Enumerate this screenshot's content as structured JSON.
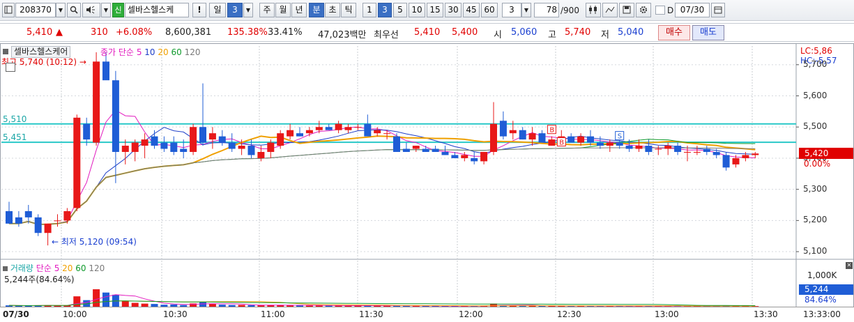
{
  "toolbar": {
    "code": "208370",
    "credit_badge": "신",
    "stock_name": "셀바스헬스케",
    "exclaim": "!",
    "period_label": "일",
    "period_value": "3",
    "periods": [
      "주",
      "월",
      "년",
      "분",
      "초",
      "틱"
    ],
    "interval_numbers": [
      "1",
      "3",
      "5",
      "10",
      "15",
      "30",
      "45",
      "60"
    ],
    "interval_value": "3",
    "count_value": "78",
    "count_total": "/900",
    "date_value": "07/30",
    "d_label": "D",
    "icons": [
      "chart-type-icon",
      "search-icon",
      "speaker-icon",
      "candle-settings-icon",
      "crosshair-icon",
      "save-icon",
      "gear-icon",
      "calendar-icon"
    ]
  },
  "infobar": {
    "price": "5,410",
    "change_arrow": "▲",
    "change": "310",
    "change_pct": "+6.08%",
    "volume": "8,600,381",
    "volume_ratio": "135.38%",
    "turnover": "33.41%",
    "amount": "47,023백만",
    "best_label": "최우선",
    "best_ask": "5,410",
    "best_bid": "5,400",
    "open_label": "시",
    "open": "5,060",
    "high_label": "고",
    "high": "5,740",
    "low_label": "저",
    "low": "5,040",
    "buy_button": "매수",
    "sell_button": "매도"
  },
  "price_chart": {
    "tab_label": "셀바스헬스케어",
    "legend_prefix": "종가 단순",
    "ma_periods": [
      "5",
      "10",
      "20",
      "60",
      "120"
    ],
    "ma_colors": [
      "#e21bbf",
      "#1f3fc8",
      "#f0a000",
      "#0f9a2c",
      "#7a7a7a"
    ],
    "high_annotation": "최고 5,740 (10:12)",
    "low_annotation": "최저 5,120 (09:54)",
    "line1_label": "5,510",
    "line2_label": "5,451",
    "lc_label": "LC:5,86",
    "hc_label": "HC:-5,57",
    "price_tag": "5,420",
    "pct_tag": "0.00%",
    "scale": [
      "5,700",
      "5,600",
      "5,500",
      "5,400",
      "5,300",
      "5,200",
      "5,100"
    ],
    "marker_b": "B",
    "marker_s": "S"
  },
  "volume_chart": {
    "legend_label": "거래량",
    "legend_prefix": "단순",
    "ma_periods": [
      "5",
      "20",
      "60",
      "120"
    ],
    "ma_colors": [
      "#e21bbf",
      "#f0a000",
      "#0f9a2c",
      "#7a7a7a"
    ],
    "value_label": "5,244주(84.64%)",
    "scale_top": "1,000K",
    "value_tag": "5,244",
    "pct_tag": "84.64%"
  },
  "time_axis": {
    "date": "07/30",
    "times": [
      "10:00",
      "10:30",
      "11:00",
      "11:30",
      "12:00",
      "12:30",
      "13:00",
      "13:30"
    ],
    "clock": "13:33:00"
  },
  "chart_data": {
    "type": "candlestick",
    "interval": "3분",
    "y_range": [
      5080,
      5760
    ],
    "candles": [
      {
        "o": 5230,
        "h": 5260,
        "l": 5190,
        "c": 5190
      },
      {
        "o": 5210,
        "h": 5230,
        "l": 5180,
        "c": 5190
      },
      {
        "o": 5230,
        "h": 5250,
        "l": 5190,
        "c": 5210
      },
      {
        "o": 5210,
        "h": 5220,
        "l": 5150,
        "c": 5160
      },
      {
        "o": 5160,
        "h": 5190,
        "l": 5120,
        "c": 5190
      },
      {
        "o": 5200,
        "h": 5220,
        "l": 5180,
        "c": 5200
      },
      {
        "o": 5200,
        "h": 5240,
        "l": 5190,
        "c": 5230
      },
      {
        "o": 5240,
        "h": 5540,
        "l": 5230,
        "c": 5530
      },
      {
        "o": 5510,
        "h": 5530,
        "l": 5440,
        "c": 5460
      },
      {
        "o": 5450,
        "h": 5740,
        "l": 5440,
        "c": 5710
      },
      {
        "o": 5710,
        "h": 5740,
        "l": 5660,
        "c": 5650
      },
      {
        "o": 5650,
        "h": 5680,
        "l": 5320,
        "c": 5420
      },
      {
        "o": 5420,
        "h": 5460,
        "l": 5380,
        "c": 5440
      },
      {
        "o": 5420,
        "h": 5460,
        "l": 5390,
        "c": 5450
      },
      {
        "o": 5440,
        "h": 5480,
        "l": 5400,
        "c": 5460
      },
      {
        "o": 5470,
        "h": 5490,
        "l": 5430,
        "c": 5440
      },
      {
        "o": 5450,
        "h": 5470,
        "l": 5420,
        "c": 5430
      },
      {
        "o": 5450,
        "h": 5470,
        "l": 5410,
        "c": 5420
      },
      {
        "o": 5430,
        "h": 5460,
        "l": 5400,
        "c": 5420
      },
      {
        "o": 5420,
        "h": 5510,
        "l": 5410,
        "c": 5500
      },
      {
        "o": 5500,
        "h": 5640,
        "l": 5440,
        "c": 5450
      },
      {
        "o": 5460,
        "h": 5500,
        "l": 5430,
        "c": 5480
      },
      {
        "o": 5470,
        "h": 5490,
        "l": 5440,
        "c": 5450
      },
      {
        "o": 5450,
        "h": 5480,
        "l": 5420,
        "c": 5430
      },
      {
        "o": 5430,
        "h": 5460,
        "l": 5410,
        "c": 5440
      },
      {
        "o": 5440,
        "h": 5460,
        "l": 5400,
        "c": 5410
      },
      {
        "o": 5400,
        "h": 5440,
        "l": 5390,
        "c": 5420
      },
      {
        "o": 5420,
        "h": 5460,
        "l": 5400,
        "c": 5450
      },
      {
        "o": 5440,
        "h": 5490,
        "l": 5430,
        "c": 5480
      },
      {
        "o": 5470,
        "h": 5510,
        "l": 5460,
        "c": 5490
      },
      {
        "o": 5480,
        "h": 5500,
        "l": 5470,
        "c": 5470
      },
      {
        "o": 5480,
        "h": 5500,
        "l": 5470,
        "c": 5490
      },
      {
        "o": 5490,
        "h": 5520,
        "l": 5480,
        "c": 5500
      },
      {
        "o": 5500,
        "h": 5510,
        "l": 5490,
        "c": 5490
      },
      {
        "o": 5490,
        "h": 5520,
        "l": 5480,
        "c": 5510
      },
      {
        "o": 5490,
        "h": 5510,
        "l": 5480,
        "c": 5500
      },
      {
        "o": 5500,
        "h": 5510,
        "l": 5490,
        "c": 5500
      },
      {
        "o": 5510,
        "h": 5540,
        "l": 5470,
        "c": 5470
      },
      {
        "o": 5480,
        "h": 5500,
        "l": 5470,
        "c": 5490
      },
      {
        "o": 5480,
        "h": 5490,
        "l": 5460,
        "c": 5480
      },
      {
        "o": 5470,
        "h": 5480,
        "l": 5420,
        "c": 5420
      },
      {
        "o": 5430,
        "h": 5450,
        "l": 5420,
        "c": 5420
      },
      {
        "o": 5430,
        "h": 5440,
        "l": 5420,
        "c": 5440
      },
      {
        "o": 5430,
        "h": 5440,
        "l": 5420,
        "c": 5420
      },
      {
        "o": 5430,
        "h": 5440,
        "l": 5420,
        "c": 5420
      },
      {
        "o": 5420,
        "h": 5440,
        "l": 5410,
        "c": 5410
      },
      {
        "o": 5410,
        "h": 5420,
        "l": 5400,
        "c": 5400
      },
      {
        "o": 5400,
        "h": 5420,
        "l": 5390,
        "c": 5410
      },
      {
        "o": 5400,
        "h": 5420,
        "l": 5380,
        "c": 5390
      },
      {
        "o": 5390,
        "h": 5420,
        "l": 5380,
        "c": 5420
      },
      {
        "o": 5420,
        "h": 5580,
        "l": 5410,
        "c": 5510
      },
      {
        "o": 5520,
        "h": 5550,
        "l": 5460,
        "c": 5470
      },
      {
        "o": 5480,
        "h": 5520,
        "l": 5460,
        "c": 5490
      },
      {
        "o": 5490,
        "h": 5500,
        "l": 5460,
        "c": 5460
      },
      {
        "o": 5460,
        "h": 5500,
        "l": 5440,
        "c": 5480
      },
      {
        "o": 5480,
        "h": 5490,
        "l": 5450,
        "c": 5450
      },
      {
        "o": 5440,
        "h": 5470,
        "l": 5440,
        "c": 5460
      },
      {
        "o": 5460,
        "h": 5490,
        "l": 5450,
        "c": 5470
      },
      {
        "o": 5470,
        "h": 5480,
        "l": 5450,
        "c": 5450
      },
      {
        "o": 5450,
        "h": 5480,
        "l": 5440,
        "c": 5470
      },
      {
        "o": 5470,
        "h": 5490,
        "l": 5440,
        "c": 5450
      },
      {
        "o": 5450,
        "h": 5470,
        "l": 5430,
        "c": 5440
      },
      {
        "o": 5440,
        "h": 5460,
        "l": 5420,
        "c": 5450
      },
      {
        "o": 5450,
        "h": 5460,
        "l": 5430,
        "c": 5440
      },
      {
        "o": 5440,
        "h": 5460,
        "l": 5420,
        "c": 5430
      },
      {
        "o": 5430,
        "h": 5460,
        "l": 5420,
        "c": 5440
      },
      {
        "o": 5440,
        "h": 5460,
        "l": 5410,
        "c": 5420
      },
      {
        "o": 5430,
        "h": 5440,
        "l": 5410,
        "c": 5430
      },
      {
        "o": 5430,
        "h": 5450,
        "l": 5410,
        "c": 5440
      },
      {
        "o": 5440,
        "h": 5450,
        "l": 5410,
        "c": 5420
      },
      {
        "o": 5420,
        "h": 5440,
        "l": 5390,
        "c": 5420
      },
      {
        "o": 5420,
        "h": 5440,
        "l": 5410,
        "c": 5420
      },
      {
        "o": 5430,
        "h": 5440,
        "l": 5410,
        "c": 5420
      },
      {
        "o": 5420,
        "h": 5430,
        "l": 5400,
        "c": 5410
      },
      {
        "o": 5410,
        "h": 5420,
        "l": 5360,
        "c": 5370
      },
      {
        "o": 5380,
        "h": 5410,
        "l": 5370,
        "c": 5400
      },
      {
        "o": 5400,
        "h": 5420,
        "l": 5390,
        "c": 5410
      },
      {
        "o": 5410,
        "h": 5420,
        "l": 5400,
        "c": 5415
      }
    ],
    "volumes": [
      12,
      9,
      8,
      11,
      14,
      10,
      12,
      95,
      60,
      160,
      130,
      110,
      55,
      35,
      28,
      25,
      18,
      20,
      15,
      30,
      45,
      25,
      18,
      15,
      16,
      14,
      12,
      14,
      16,
      12,
      11,
      10,
      12,
      9,
      10,
      8,
      8,
      12,
      9,
      8,
      10,
      7,
      6,
      7,
      6,
      6,
      5,
      6,
      6,
      7,
      28,
      14,
      9,
      8,
      8,
      7,
      6,
      6,
      6,
      7,
      6,
      5,
      6,
      5,
      5,
      6,
      6,
      5,
      5,
      5,
      6,
      5,
      5,
      5,
      8,
      6,
      5,
      5
    ],
    "volume_range": [
      0,
      1000
    ]
  }
}
